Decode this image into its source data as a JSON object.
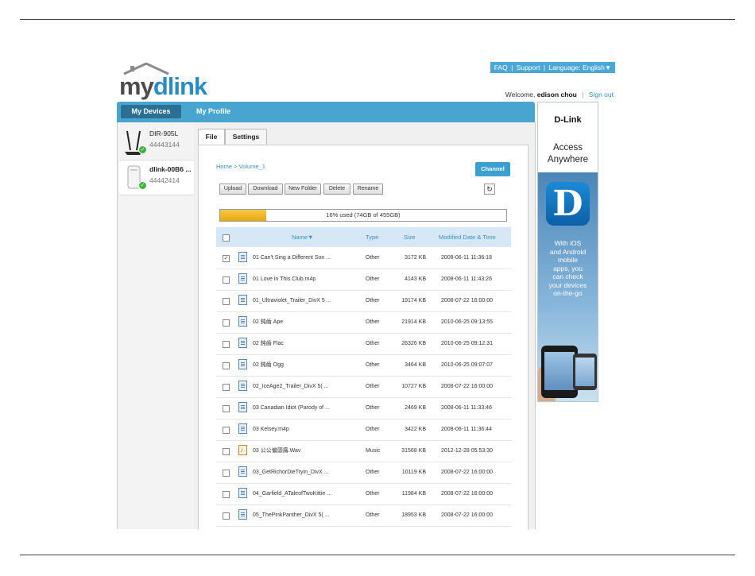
{
  "logo": {
    "prefix": "my",
    "suffix": "dlink"
  },
  "topbar": {
    "faq": "FAQ",
    "support": "Support",
    "language": "Language: English▼",
    "separator": "|"
  },
  "welcome": {
    "prefix": "Welcome,",
    "user": "edison chou",
    "separator": "|",
    "signout": "Sign out"
  },
  "nav": {
    "devices": "My Devices",
    "profile": "My Profile"
  },
  "devices": [
    {
      "name": "DIR-905L",
      "id": "44443144"
    },
    {
      "name": "dlink-00B6 ...",
      "id": "44442414"
    }
  ],
  "tabs": {
    "file": "File",
    "settings": "Settings"
  },
  "breadcrumb": "Home > Volume_1",
  "channel_label": "Channel",
  "toolbar": {
    "upload": "Upload",
    "download": "Download",
    "new_folder": "New Folder",
    "delete": "Delete",
    "rename": "Rename"
  },
  "usage": {
    "text": "16% used (74GB of 455GB)",
    "percent": 16
  },
  "table": {
    "headers": {
      "name": "Name▼",
      "type": "Type",
      "size": "Size",
      "modified": "Modified Date & Time"
    },
    "rows": [
      {
        "name": "01 Can't Sing a Different Son ...",
        "type": "Other",
        "size": "3172 KB",
        "modified": "2008-06-11 11:36:18",
        "checked": true,
        "icon": "file-icon"
      },
      {
        "name": "01 Love in This Club.m4p",
        "type": "Other",
        "size": "4143 KB",
        "modified": "2008-06-11 11:43:26",
        "checked": false,
        "icon": "file-icon"
      },
      {
        "name": "01_Ultraviolet_Trailer_DivX 5 ...",
        "type": "Other",
        "size": "19174 KB",
        "modified": "2008-07-22 16:00:00",
        "checked": false,
        "icon": "file-icon"
      },
      {
        "name": "02 鈍齒 Ape",
        "type": "Other",
        "size": "21914 KB",
        "modified": "2010-06-25 09:13:55",
        "checked": false,
        "icon": "file-icon"
      },
      {
        "name": "02 鈍齒 Flac",
        "type": "Other",
        "size": "26326 KB",
        "modified": "2010-06-25 09:12:31",
        "checked": false,
        "icon": "file-icon"
      },
      {
        "name": "02 鈍齒 Ogg",
        "type": "Other",
        "size": "3464 KB",
        "modified": "2010-06-25 09:07:07",
        "checked": false,
        "icon": "file-icon"
      },
      {
        "name": "02_IceAge2_Trailer_DivX 5( ...",
        "type": "Other",
        "size": "10727 KB",
        "modified": "2008-07-22 16:00:00",
        "checked": false,
        "icon": "file-icon"
      },
      {
        "name": "03 Canadian Idiot (Parody of ...",
        "type": "Other",
        "size": "2469 KB",
        "modified": "2008-06-11 11:33:46",
        "checked": false,
        "icon": "file-icon"
      },
      {
        "name": "03 Kelsey.m4p",
        "type": "Other",
        "size": "3422 KB",
        "modified": "2008-06-11 11:36:44",
        "checked": false,
        "icon": "file-icon"
      },
      {
        "name": "03 公公偏頭痛.Wav",
        "type": "Music",
        "size": "31568 KB",
        "modified": "2012-12-28 05:53:30",
        "checked": false,
        "icon": "music-icon"
      },
      {
        "name": "03_GetRichorDieTryin_DivX ...",
        "type": "Other",
        "size": "10119 KB",
        "modified": "2008-07-22 16:00:00",
        "checked": false,
        "icon": "file-icon"
      },
      {
        "name": "04_Garfield_ATaleofTwoKittie ...",
        "type": "Other",
        "size": "11984 KB",
        "modified": "2008-07-22 16:00:00",
        "checked": false,
        "icon": "file-icon"
      },
      {
        "name": "05_ThePinkPanther_DivX 5( ...",
        "type": "Other",
        "size": "18953 KB",
        "modified": "2008-07-22 16:00:00",
        "checked": false,
        "icon": "file-icon"
      }
    ]
  },
  "ad": {
    "brand": "D-Link",
    "slogan_line1": "Access",
    "slogan_line2": "Anywhere",
    "logo_letter": "D",
    "blurb": [
      "With iOS",
      "and Android",
      "mobile",
      "apps, you",
      "can check",
      "your devices",
      "on-the-go"
    ]
  },
  "colors": {
    "accent": "#48a5cf",
    "accent_dark": "#2b6f93",
    "usage_fill": "#f0b320",
    "link": "#3b8fc4"
  }
}
